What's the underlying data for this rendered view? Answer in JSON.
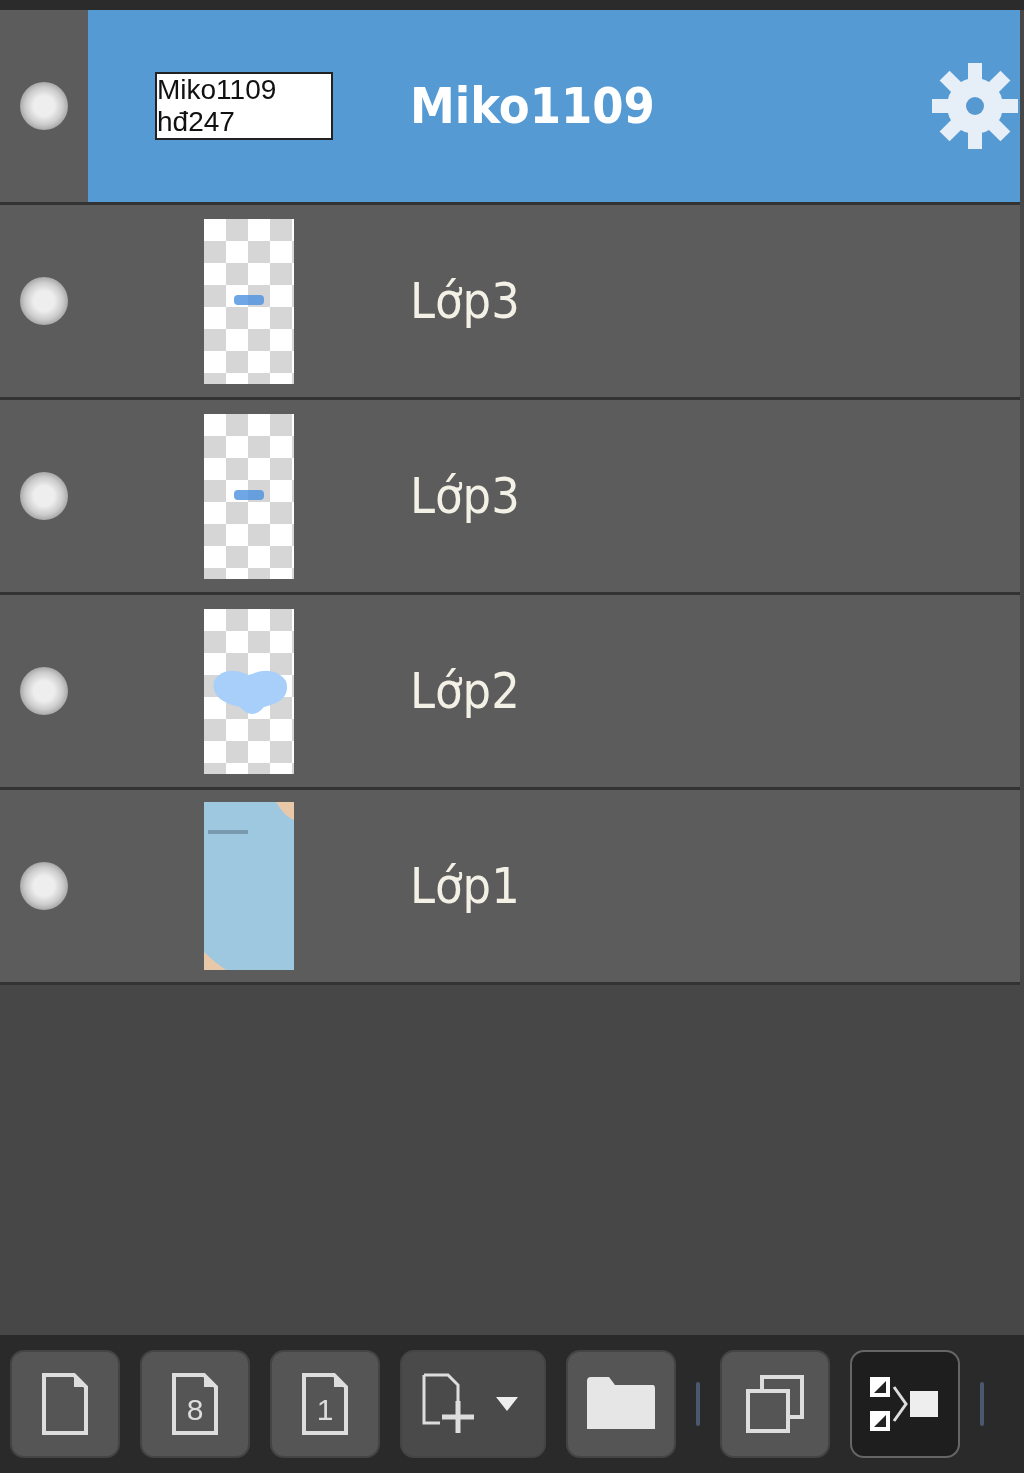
{
  "layers": [
    {
      "name": "Miko1109",
      "selected": true,
      "visible": true,
      "settings": true,
      "thumbnail": {
        "kind": "text",
        "lines": [
          "Miko1109",
          "hđ247"
        ]
      }
    },
    {
      "name": "Lớp3",
      "selected": false,
      "visible": true,
      "settings": false,
      "thumbnail": {
        "kind": "mark"
      }
    },
    {
      "name": "Lớp3",
      "selected": false,
      "visible": true,
      "settings": false,
      "thumbnail": {
        "kind": "mark"
      }
    },
    {
      "name": "Lớp2",
      "selected": false,
      "visible": true,
      "settings": false,
      "thumbnail": {
        "kind": "blob"
      }
    },
    {
      "name": "Lớp1",
      "selected": false,
      "visible": true,
      "settings": false,
      "thumbnail": {
        "kind": "fill"
      }
    }
  ],
  "toolbar": [
    {
      "kind": "new",
      "selected": false
    },
    {
      "kind": "page",
      "label": "8",
      "selected": false
    },
    {
      "kind": "page",
      "label": "1",
      "selected": false
    },
    {
      "kind": "add",
      "selected": false
    },
    {
      "kind": "folder",
      "selected": false
    },
    {
      "kind": "separator"
    },
    {
      "kind": "copy",
      "selected": false
    },
    {
      "kind": "merge",
      "selected": true
    },
    {
      "kind": "separator"
    }
  ]
}
